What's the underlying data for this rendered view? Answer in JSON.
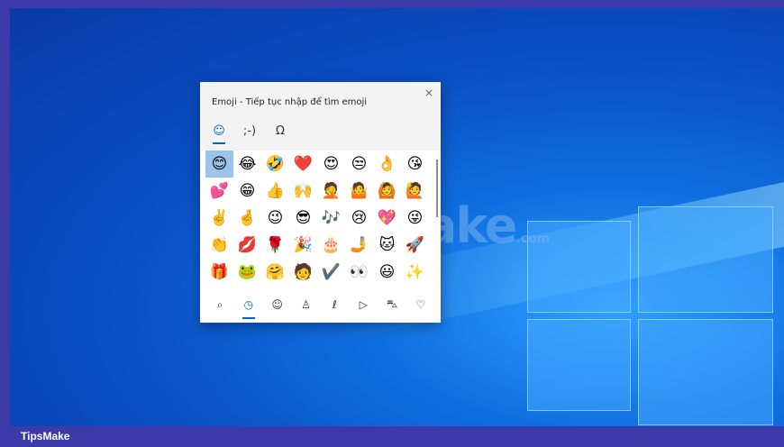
{
  "taskbar": {
    "brand": "TipsMake"
  },
  "watermark": {
    "main": "TipsMake",
    "suffix": ".com"
  },
  "panel": {
    "title": "Emoji - Tiếp tục nhập để tìm emoji",
    "close_label": "×",
    "tabs": [
      {
        "name": "tab-emoji",
        "label": "☺",
        "active": true
      },
      {
        "name": "tab-kaomoji",
        "label": ";-)",
        "active": false
      },
      {
        "name": "tab-symbols",
        "label": "Ω",
        "active": false
      }
    ],
    "emoji_rows": [
      [
        "😊",
        "😂",
        "🤣",
        "❤️",
        "😍",
        "😒",
        "👌",
        "😘"
      ],
      [
        "💕",
        "😁",
        "👍",
        "🙌",
        "🤦",
        "🤷",
        "🙆",
        "🙋"
      ],
      [
        "✌️",
        "🤞",
        "😉",
        "😎",
        "🎶",
        "😢",
        "💖",
        "😜"
      ],
      [
        "👏",
        "💋",
        "🌹",
        "🎉",
        "🎂",
        "🤳",
        "🐱",
        "🚀"
      ],
      [
        "🎁",
        "🐸",
        "🤗",
        "🧑",
        "✔️",
        "👀",
        "😃",
        "✨"
      ]
    ],
    "categories": [
      {
        "name": "search-icon",
        "label": "⌕",
        "active": false
      },
      {
        "name": "recent-icon",
        "label": "◷",
        "active": true
      },
      {
        "name": "smiley-icon",
        "label": "☺",
        "active": false
      },
      {
        "name": "people-icon",
        "label": "♙",
        "active": false
      },
      {
        "name": "celebration-icon",
        "label": "ℓ",
        "active": false
      },
      {
        "name": "food-icon",
        "label": "▷",
        "active": false
      },
      {
        "name": "car-icon",
        "label": "⛍",
        "active": false
      },
      {
        "name": "heart-icon",
        "label": "♡",
        "active": false
      }
    ]
  }
}
